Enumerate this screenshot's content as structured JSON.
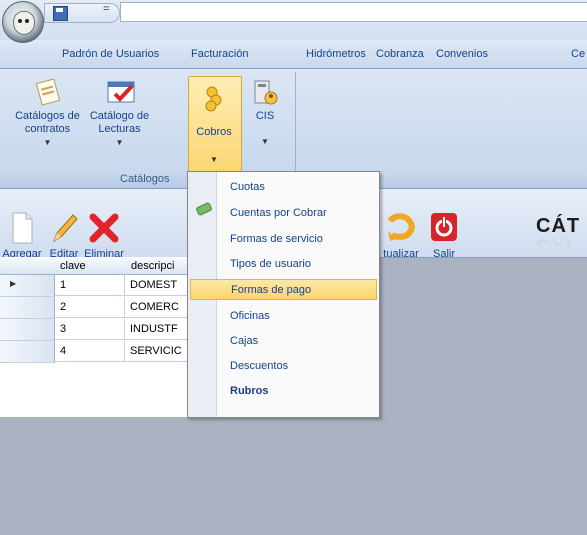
{
  "qat": {
    "dropdown_glyph": "="
  },
  "menubar": {
    "items": [
      "Padrón de Usuarios",
      "Facturación",
      "Hidrómetros",
      "Cobranza",
      "Convenios",
      "Ce"
    ]
  },
  "ribbon": {
    "buttons": [
      {
        "label1": "Catálogos de",
        "label2": "contratos",
        "icon": "contracts-icon"
      },
      {
        "label1": "Catálogo de",
        "label2": "Lecturas",
        "icon": "readings-icon"
      },
      {
        "label1": "Cobros",
        "label2": "",
        "icon": "coins-icon"
      },
      {
        "label1": "CIS",
        "label2": "",
        "icon": "cis-icon"
      }
    ],
    "group_label": "Catálogos"
  },
  "toolbar": {
    "buttons": [
      "Agregar",
      "Editar",
      "Eliminar",
      "tualizar",
      "Salir"
    ],
    "title": "CÁT",
    "title_partial": "CYI"
  },
  "grid": {
    "headers": [
      "clave",
      "descripci"
    ],
    "rows": [
      {
        "clave": "1",
        "descripcion": "DOMEST"
      },
      {
        "clave": "2",
        "descripcion": "COMERC"
      },
      {
        "clave": "3",
        "descripcion": "INDUSTF"
      },
      {
        "clave": "4",
        "descripcion": "SERVICIC"
      }
    ]
  },
  "dropdown_menu": {
    "items": [
      "Cuotas",
      "Cuentas por Cobrar",
      "Formas de servicio",
      "Tipos de usuario",
      "Formas de pago",
      "Oficinas",
      "Cajas",
      "Descuentos",
      "Rubros"
    ],
    "highlighted": "Formas de pago"
  }
}
